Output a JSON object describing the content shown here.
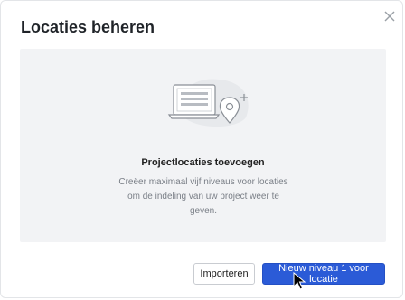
{
  "dialog": {
    "title": "Locaties beheren",
    "close_icon": "close-icon"
  },
  "empty_state": {
    "illustration": "location-screen-illustration",
    "heading": "Projectlocaties toevoegen",
    "description": "Creëer maximaal vijf niveaus voor locaties om de indeling van uw project weer te geven."
  },
  "footer": {
    "import_label": "Importeren",
    "new_level_label": "Nieuw niveau 1 voor locatie"
  },
  "colors": {
    "primary": "#2b5bd7",
    "panel": "#f2f3f5"
  }
}
